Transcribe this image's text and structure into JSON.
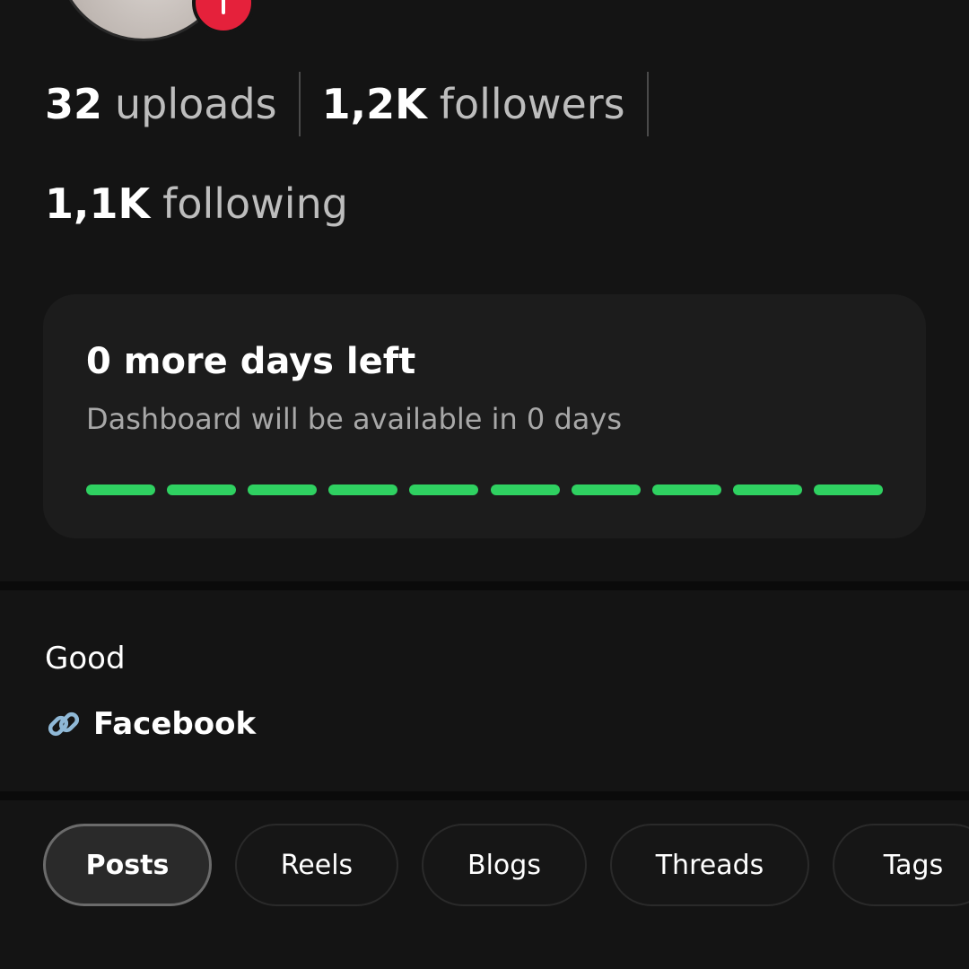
{
  "stats": {
    "uploads": {
      "value": "32",
      "label": "uploads"
    },
    "followers": {
      "value": "1,2K",
      "label": "followers"
    },
    "following": {
      "value": "1,1K",
      "label": "following"
    }
  },
  "dashboard_card": {
    "title": "0 more days left",
    "subtitle": "Dashboard will be available in 0 days",
    "progress": {
      "segments_total": 10,
      "segments_filled": 10,
      "color": "#2fd161"
    }
  },
  "bio": {
    "text": "Good",
    "link": {
      "icon": "link-icon",
      "label": "Facebook"
    }
  },
  "tabs": [
    {
      "label": "Posts",
      "active": true
    },
    {
      "label": "Reels",
      "active": false
    },
    {
      "label": "Blogs",
      "active": false
    },
    {
      "label": "Threads",
      "active": false
    },
    {
      "label": "Tags",
      "active": false
    }
  ],
  "colors": {
    "background": "#141414",
    "card": "#1c1c1c",
    "accent_green": "#2fd161",
    "badge_red": "#e5213b"
  }
}
